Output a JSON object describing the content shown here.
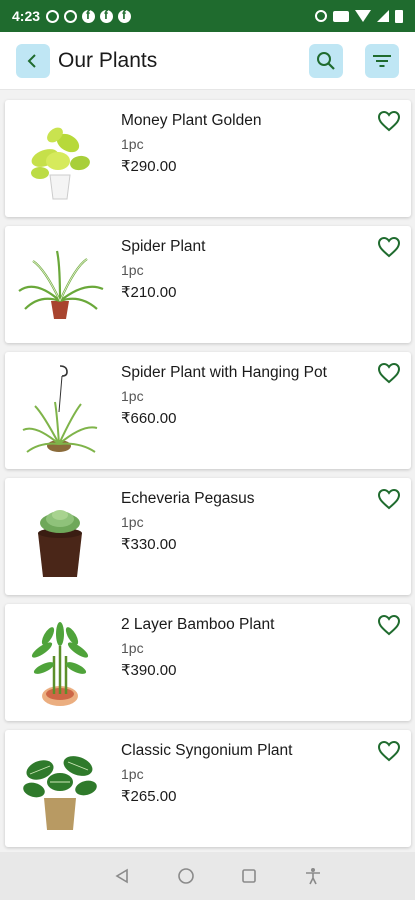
{
  "status_bar": {
    "time": "4:23",
    "left_icons": [
      "whatsapp-icon",
      "whatsapp-icon",
      "facebook-icon",
      "facebook-icon",
      "facebook-icon"
    ],
    "right_icons": [
      "alarm-icon",
      "nfc-icon",
      "wifi-icon",
      "signal-icon",
      "battery-icon"
    ]
  },
  "app_bar": {
    "title": "Our Plants",
    "back_icon": "chevron-left-icon",
    "search_icon": "search-icon",
    "filter_icon": "filter-icon"
  },
  "colors": {
    "brand_green": "#1f6b2e",
    "icon_button_bg": "#bfe6f4",
    "heart": "#1f6b2e"
  },
  "products": [
    {
      "name": "Money Plant Golden",
      "qty": "1pc",
      "price": "₹290.00",
      "image": "money-plant-golden-image"
    },
    {
      "name": "Spider Plant",
      "qty": "1pc",
      "price": "₹210.00",
      "image": "spider-plant-image"
    },
    {
      "name": "Spider Plant with Hanging Pot",
      "qty": "1pc",
      "price": "₹660.00",
      "image": "spider-plant-hanging-image"
    },
    {
      "name": "Echeveria Pegasus",
      "qty": "1pc",
      "price": "₹330.00",
      "image": "echeveria-image"
    },
    {
      "name": "2 Layer Bamboo Plant",
      "qty": "1pc",
      "price": "₹390.00",
      "image": "bamboo-plant-image"
    },
    {
      "name": "Classic Syngonium Plant",
      "qty": "1pc",
      "price": "₹265.00",
      "image": "syngonium-image"
    }
  ],
  "nav_bar": {
    "icons": [
      "back-triangle-icon",
      "home-circle-icon",
      "recents-square-icon",
      "accessibility-icon"
    ]
  }
}
